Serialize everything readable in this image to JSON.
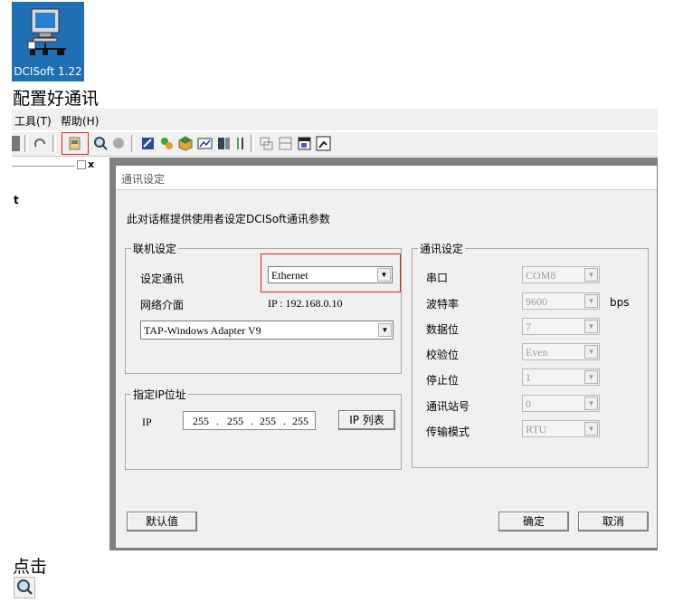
{
  "desktop_icon": {
    "label": "DCISoft 1.22",
    "icon": "computer-network-icon"
  },
  "doc": {
    "heading1": "配置好通讯",
    "heading2": "点击"
  },
  "menu": {
    "tools": "工具(T)",
    "help": "帮助(H)"
  },
  "toolbar": {
    "icons": [
      "document-icon",
      "refresh-icon",
      "device-icon",
      "search-icon",
      "circle-icon",
      "tool-icon",
      "settings-icon",
      "box-icon",
      "chart-icon",
      "monitor-icon",
      "columns-icon",
      "window1-icon",
      "window2-icon",
      "window3-icon",
      "zoom-icon"
    ]
  },
  "left_pane": {
    "close_label": "x",
    "item_fragment": "t"
  },
  "dialog": {
    "title": "通讯设定",
    "description": "此对话框提供使用者设定DCISoft通讯参数",
    "connection": {
      "legend": "联机设定",
      "comm_label": "设定通讯",
      "comm_value": "Ethernet",
      "iface_label": "网络介面",
      "ip_text": "IP : 192.168.0.10",
      "adapter_value": "TAP-Windows Adapter V9"
    },
    "ip": {
      "legend": "指定IP位址",
      "label": "IP",
      "octets": [
        "255",
        "255",
        "255",
        "255"
      ],
      "list_button": "IP 列表"
    },
    "comm": {
      "legend": "通讯设定",
      "port_label": "串口",
      "port_value": "COM8",
      "baud_label": "波特率",
      "baud_value": "9600",
      "baud_unit": "bps",
      "databits_label": "数据位",
      "databits_value": "7",
      "parity_label": "校验位",
      "parity_value": "Even",
      "stopbits_label": "停止位",
      "stopbits_value": "1",
      "station_label": "通讯站号",
      "station_value": "0",
      "mode_label": "传输模式",
      "mode_value": "RTU"
    },
    "buttons": {
      "default": "默认值",
      "ok": "确定",
      "cancel": "取消"
    }
  },
  "colors": {
    "highlight_box": "#d22222",
    "desktop_bg": "#1e6fb3"
  }
}
